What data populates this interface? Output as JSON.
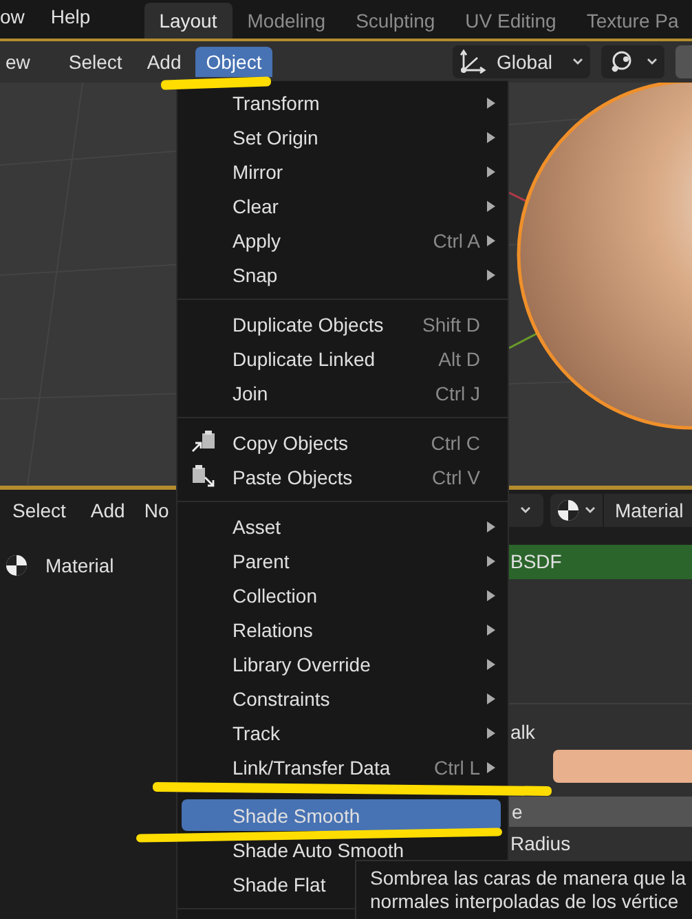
{
  "top_menu": [
    "ow",
    "Help"
  ],
  "workspace_tabs": [
    {
      "label": "Layout",
      "selected": true
    },
    {
      "label": "Modeling",
      "selected": false
    },
    {
      "label": "Sculpting",
      "selected": false
    },
    {
      "label": "UV Editing",
      "selected": false
    },
    {
      "label": "Texture Pa",
      "selected": false
    }
  ],
  "viewport_header": {
    "menus": [
      {
        "label": "ew",
        "selected": false
      },
      {
        "label": "Select",
        "selected": false
      },
      {
        "label": "Add",
        "selected": false
      },
      {
        "label": "Object",
        "selected": true
      }
    ],
    "orientation": "Global"
  },
  "node_header": {
    "menus": [
      "Select",
      "Add",
      "No"
    ],
    "shading": "Material"
  },
  "material_slot": "Material",
  "node": {
    "title": "BSDF",
    "rows": [
      {
        "kind": "label",
        "text": "alk"
      },
      {
        "kind": "color",
        "color": "#e8b08c"
      },
      {
        "kind": "field",
        "text": "e"
      },
      {
        "kind": "label",
        "text": "Radius"
      }
    ]
  },
  "object_menu": {
    "sections": [
      [
        {
          "kind": "plain",
          "label": "Transform",
          "submenu": true,
          "selected": false
        },
        {
          "kind": "plain",
          "label": "Set Origin",
          "submenu": true,
          "selected": false
        },
        {
          "kind": "plain",
          "label": "Mirror",
          "submenu": true,
          "selected": false
        },
        {
          "kind": "plain",
          "label": "Clear",
          "submenu": true,
          "selected": false
        },
        {
          "kind": "plain",
          "label": "Apply",
          "shortcut": "Ctrl A",
          "submenu": true,
          "selected": false
        },
        {
          "kind": "plain",
          "label": "Snap",
          "submenu": true,
          "selected": false
        }
      ],
      [
        {
          "kind": "plain",
          "label": "Duplicate Objects",
          "shortcut": "Shift D",
          "submenu": false,
          "selected": false
        },
        {
          "kind": "plain",
          "label": "Duplicate Linked",
          "shortcut": "Alt D",
          "submenu": false,
          "selected": false
        },
        {
          "kind": "plain",
          "label": "Join",
          "shortcut": "Ctrl J",
          "submenu": false,
          "selected": false
        }
      ],
      [
        {
          "kind": "copy",
          "label": "Copy Objects",
          "shortcut": "Ctrl C",
          "submenu": false,
          "selected": false
        },
        {
          "kind": "paste",
          "label": "Paste Objects",
          "shortcut": "Ctrl V",
          "submenu": false,
          "selected": false
        }
      ],
      [
        {
          "kind": "plain",
          "label": "Asset",
          "submenu": true,
          "selected": false
        },
        {
          "kind": "plain",
          "label": "Parent",
          "submenu": true,
          "selected": false
        },
        {
          "kind": "plain",
          "label": "Collection",
          "submenu": true,
          "selected": false
        },
        {
          "kind": "plain",
          "label": "Relations",
          "submenu": true,
          "selected": false
        },
        {
          "kind": "plain",
          "label": "Library Override",
          "submenu": true,
          "selected": false
        },
        {
          "kind": "plain",
          "label": "Constraints",
          "submenu": true,
          "selected": false
        },
        {
          "kind": "plain",
          "label": "Track",
          "submenu": true,
          "selected": false
        },
        {
          "kind": "plain",
          "label": "Link/Transfer Data",
          "shortcut": "Ctrl L",
          "submenu": true,
          "selected": false
        }
      ],
      [
        {
          "kind": "plain",
          "label": "Shade Smooth",
          "submenu": false,
          "selected": true
        },
        {
          "kind": "plain",
          "label": "Shade Auto Smooth",
          "submenu": false,
          "selected": false
        },
        {
          "kind": "plain",
          "label": "Shade Flat",
          "selected": false
        }
      ]
    ]
  },
  "tooltip": [
    "Sombrea las caras de manera que la",
    "normales interpoladas de los vértice"
  ]
}
